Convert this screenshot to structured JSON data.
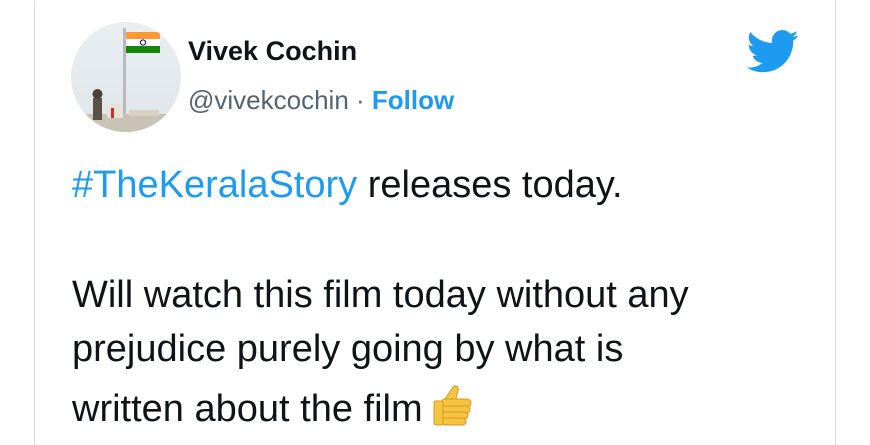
{
  "tweet": {
    "author_name": "Vivek Cochin",
    "handle": "@vivekcochin",
    "separator": "·",
    "follow_label": "Follow",
    "hashtag": "#TheKeralaStory",
    "line1_rest": " releases today.",
    "line2": "Will watch this film today without any",
    "line3": "prejudice purely going by what is",
    "line4": "written about the film"
  },
  "icons": {
    "brand": "twitter-bird-icon",
    "avatar": "avatar-flag-image",
    "emoji": "thumbs-up-emoji"
  },
  "colors": {
    "accent": "#1d9bf0",
    "text": "#0f1419",
    "muted": "#536471",
    "border": "#cfd9de"
  }
}
